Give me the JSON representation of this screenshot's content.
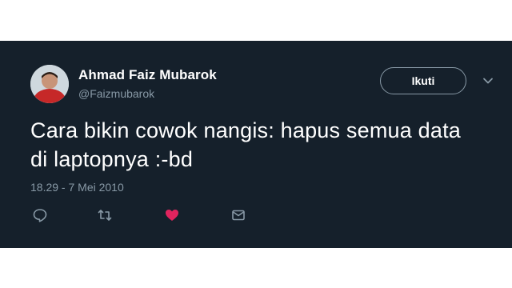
{
  "user": {
    "display_name": "Ahmad Faiz Mubarok",
    "handle": "@Faizmubarok"
  },
  "follow_button": {
    "label": "Ikuti"
  },
  "tweet": {
    "text_line1": "Cara bikin cowok nangis: hapus semua data",
    "text_line2": "di laptopnya :-bd",
    "timestamp": "18.29 - 7 Mei 2010"
  },
  "icons": {
    "reply": "reply-icon",
    "retweet": "retweet-icon",
    "like": "heart-icon",
    "dm": "envelope-icon",
    "more": "chevron-down-icon"
  },
  "colors": {
    "background": "#15202b",
    "text": "#ffffff",
    "muted": "#8899a6",
    "like": "#e0245e"
  }
}
